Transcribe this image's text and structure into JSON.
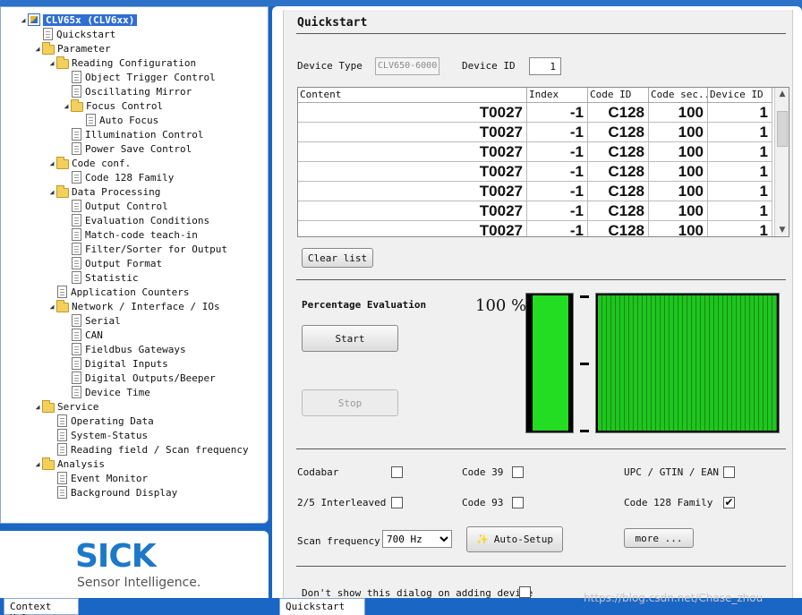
{
  "tree": {
    "items": [
      {
        "label": "CLV65x (CLV6xx)",
        "icon": "device",
        "selected": true,
        "expanded": true
      },
      {
        "label": "Quickstart",
        "icon": "doc"
      },
      {
        "label": "Parameter",
        "icon": "folder",
        "expanded": true
      },
      {
        "label": "Reading Configuration",
        "icon": "folder",
        "expanded": true
      },
      {
        "label": "Object Trigger Control",
        "icon": "doc"
      },
      {
        "label": "Oscillating Mirror",
        "icon": "doc"
      },
      {
        "label": "Focus Control",
        "icon": "folder",
        "expanded": true
      },
      {
        "label": "Auto Focus",
        "icon": "doc"
      },
      {
        "label": "Illumination Control",
        "icon": "doc"
      },
      {
        "label": "Power Save Control",
        "icon": "doc"
      },
      {
        "label": "Code conf.",
        "icon": "folder",
        "expanded": true
      },
      {
        "label": "Code 128 Family",
        "icon": "doc"
      },
      {
        "label": "Data Processing",
        "icon": "folder",
        "expanded": true
      },
      {
        "label": "Output Control",
        "icon": "doc"
      },
      {
        "label": "Evaluation Conditions",
        "icon": "doc"
      },
      {
        "label": "Match-code teach-in",
        "icon": "doc"
      },
      {
        "label": "Filter/Sorter for Output",
        "icon": "doc"
      },
      {
        "label": "Output Format",
        "icon": "doc"
      },
      {
        "label": "Statistic",
        "icon": "doc"
      },
      {
        "label": "Application Counters",
        "icon": "doc"
      },
      {
        "label": "Network / Interface / IOs",
        "icon": "folder",
        "expanded": true
      },
      {
        "label": "Serial",
        "icon": "doc"
      },
      {
        "label": "CAN",
        "icon": "doc"
      },
      {
        "label": "Fieldbus Gateways",
        "icon": "doc"
      },
      {
        "label": "Digital Inputs",
        "icon": "doc"
      },
      {
        "label": "Digital Outputs/Beeper",
        "icon": "doc"
      },
      {
        "label": "Device Time",
        "icon": "doc"
      },
      {
        "label": "Service",
        "icon": "folder",
        "expanded": true
      },
      {
        "label": "Operating Data",
        "icon": "doc"
      },
      {
        "label": "System-Status",
        "icon": "doc"
      },
      {
        "label": "Reading field / Scan frequency",
        "icon": "doc"
      },
      {
        "label": "Analysis",
        "icon": "folder",
        "expanded": true
      },
      {
        "label": "Event Monitor",
        "icon": "doc"
      },
      {
        "label": "Background Display",
        "icon": "doc"
      }
    ]
  },
  "logo": {
    "brand": "SICK",
    "tagline": "Sensor Intelligence."
  },
  "tabs": {
    "context_help": "Context Help",
    "quickstart": "Quickstart"
  },
  "main": {
    "title": "Quickstart",
    "device_type_label": "Device Type",
    "device_type_value": "CLV650-6000",
    "device_id_label": "Device ID",
    "device_id_value": "1",
    "grid": {
      "columns": [
        "Content",
        "Index",
        "Code ID",
        "Code sec...",
        "Device ID"
      ],
      "rows": [
        [
          "T0027",
          "-1",
          "C128",
          "100",
          "1"
        ],
        [
          "T0027",
          "-1",
          "C128",
          "100",
          "1"
        ],
        [
          "T0027",
          "-1",
          "C128",
          "100",
          "1"
        ],
        [
          "T0027",
          "-1",
          "C128",
          "100",
          "1"
        ],
        [
          "T0027",
          "-1",
          "C128",
          "100",
          "1"
        ],
        [
          "T0027",
          "-1",
          "C128",
          "100",
          "1"
        ],
        [
          "T0027",
          "-1",
          "C128",
          "100",
          "1"
        ]
      ]
    },
    "clear_list": "Clear list",
    "eval_title": "Percentage Evaluation",
    "start": "Start",
    "stop": "Stop",
    "percentage": "100 %",
    "percentage_level": 1.0,
    "codes": {
      "codabar": {
        "label": "Codabar",
        "checked": false
      },
      "code39": {
        "label": "Code 39",
        "checked": false
      },
      "upc": {
        "label": "UPC / GTIN / EAN",
        "checked": false
      },
      "interleaved": {
        "label": "2/5 Interleaved",
        "checked": false
      },
      "code93": {
        "label": "Code 93",
        "checked": false
      },
      "code128": {
        "label": "Code 128 Family",
        "checked": true
      }
    },
    "scan_freq_label": "Scan frequency",
    "scan_freq_value": "700 Hz",
    "auto_setup": "Auto-Setup",
    "more": "more ...",
    "dont_show": "Don't show this dialog on adding device"
  },
  "watermark": "https://blog.csdn.net/Chase_zhou",
  "colors": {
    "accent": "#2f6fd1",
    "bar_green": "#22dd22",
    "brand_blue": "#1e78c8"
  }
}
